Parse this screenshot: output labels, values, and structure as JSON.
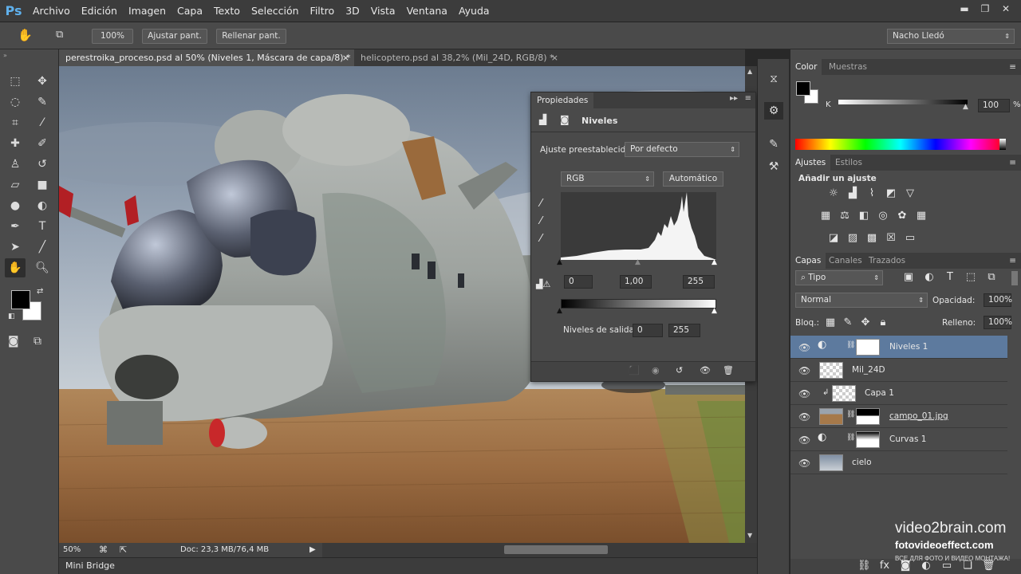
{
  "app": {
    "logo": "Ps"
  },
  "menu": [
    "Archivo",
    "Edición",
    "Imagen",
    "Capa",
    "Texto",
    "Selección",
    "Filtro",
    "3D",
    "Vista",
    "Ventana",
    "Ayuda"
  ],
  "options_bar": {
    "zoom": "100%",
    "fit_screen": "Ajustar pant.",
    "fill_screen": "Rellenar pant.",
    "workspace": "Nacho Lledó"
  },
  "doc_tabs": [
    {
      "label": "perestroika_proceso.psd al 50% (Niveles 1, Máscara de capa/8) *",
      "close": "×"
    },
    {
      "label": "helicoptero.psd al 38,2% (Mil_24D, RGB/8) *",
      "close": "×"
    }
  ],
  "status": {
    "zoom": "50%",
    "doc": "Doc: 23,3 MB/76,4 MB"
  },
  "mini_bridge": "Mini Bridge",
  "properties": {
    "tab": "Propiedades",
    "title": "Niveles",
    "preset_label": "Ajuste preestablecido:",
    "preset_value": "Por defecto",
    "channel": "RGB",
    "auto": "Automático",
    "input_black": "0",
    "input_gamma": "1,00",
    "input_white": "255",
    "output_label": "Niveles de salida:",
    "output_black": "0",
    "output_white": "255"
  },
  "color_panel": {
    "tabs": [
      "Color",
      "Muestras"
    ],
    "channel_label": "K",
    "value": "100",
    "unit": "%"
  },
  "adjust_panel": {
    "tabs": [
      "Ajustes",
      "Estilos"
    ],
    "heading": "Añadir un ajuste"
  },
  "layers_panel": {
    "tabs": [
      "Capas",
      "Canales",
      "Trazados"
    ],
    "filter": "Tipo",
    "blend_mode": "Normal",
    "opacity_label": "Opacidad:",
    "opacity": "100%",
    "lock_label": "Bloq.:",
    "fill_label": "Relleno:",
    "fill": "100%",
    "layers": [
      {
        "name": "Niveles 1",
        "selected": true
      },
      {
        "name": "Mil_24D",
        "selected": false
      },
      {
        "name": "Capa 1",
        "selected": false
      },
      {
        "name": "campo_01.jpg",
        "selected": false
      },
      {
        "name": "Curvas 1",
        "selected": false
      },
      {
        "name": "cielo",
        "selected": false
      }
    ]
  },
  "watermark": {
    "brand": "video2brain.com",
    "site": "fotovideoeffect.com",
    "tagline": "ВСЕ ДЛЯ ФОТО И ВИДЕО МОНТАЖА!"
  },
  "colors": {
    "accent": "#5fb0ec",
    "selection": "#5d7a9e"
  }
}
